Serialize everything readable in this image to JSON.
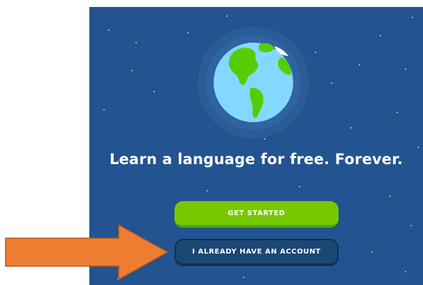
{
  "onboarding": {
    "headline": "Learn a language for free. Forever.",
    "primary_button": "GET STARTED",
    "secondary_button": "I ALREADY HAVE AN ACCOUNT"
  },
  "colors": {
    "background": "#235390",
    "primary_button": "#78c800",
    "secondary_button": "#1b4775",
    "arrow": "#ec7d31"
  },
  "icons": {
    "globe": "globe-icon",
    "arrow": "arrow-right-icon"
  }
}
